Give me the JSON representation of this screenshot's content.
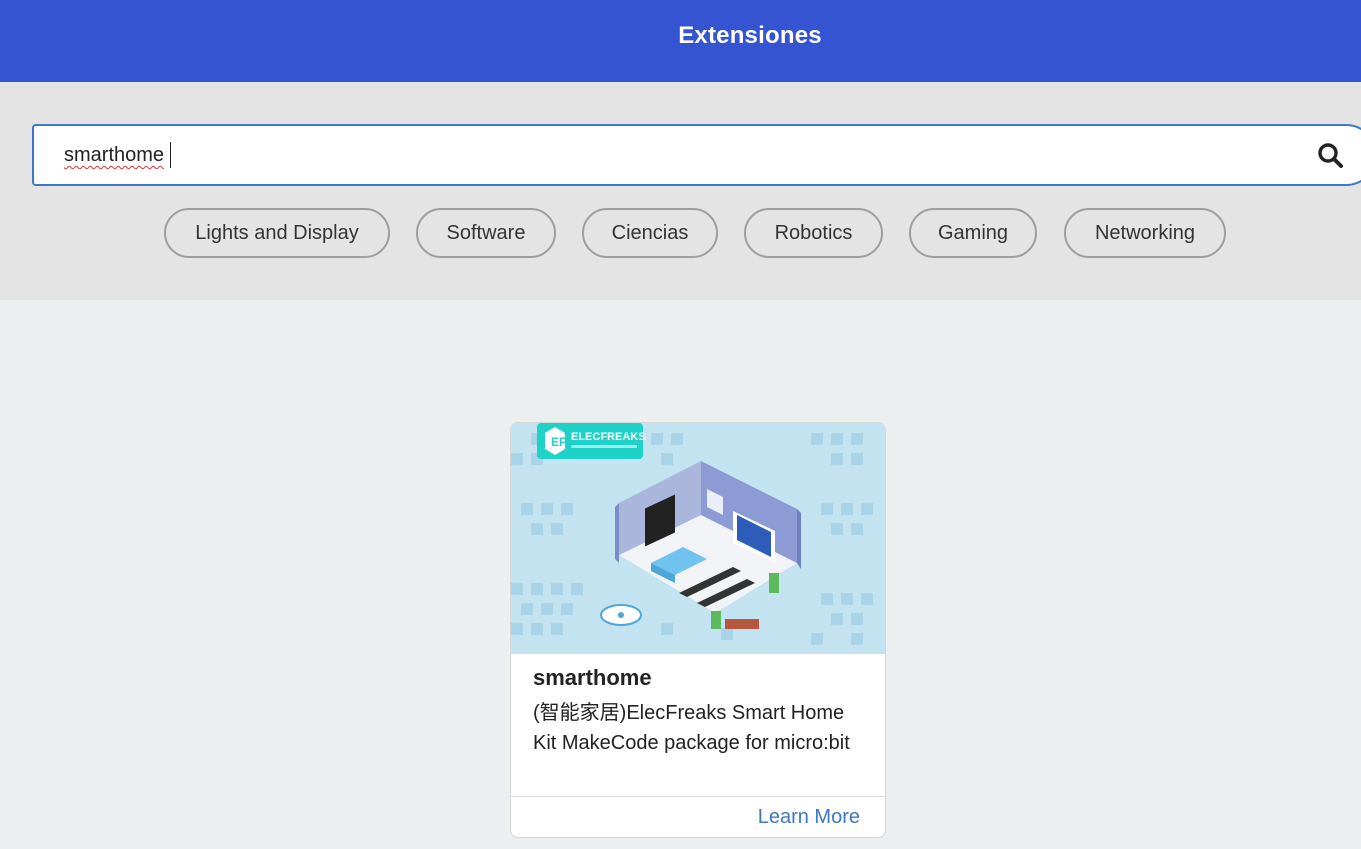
{
  "header": {
    "title": "Extensiones"
  },
  "search": {
    "value": "smarthome",
    "icon": "search-icon"
  },
  "categories": [
    "Lights and Display",
    "Software",
    "Ciencias",
    "Robotics",
    "Gaming",
    "Networking"
  ],
  "results": [
    {
      "title": "smarthome",
      "description": "(智能家居)ElecFreaks Smart Home Kit MakeCode package for micro:bit",
      "image_logo_text": "ELECFREAKS",
      "learn_more_label": "Learn More"
    }
  ],
  "colors": {
    "header": "#3454d1",
    "accent": "#3b78c8",
    "card_image_bg": "#c3e3f1",
    "logo_teal": "#1fd2c8"
  }
}
